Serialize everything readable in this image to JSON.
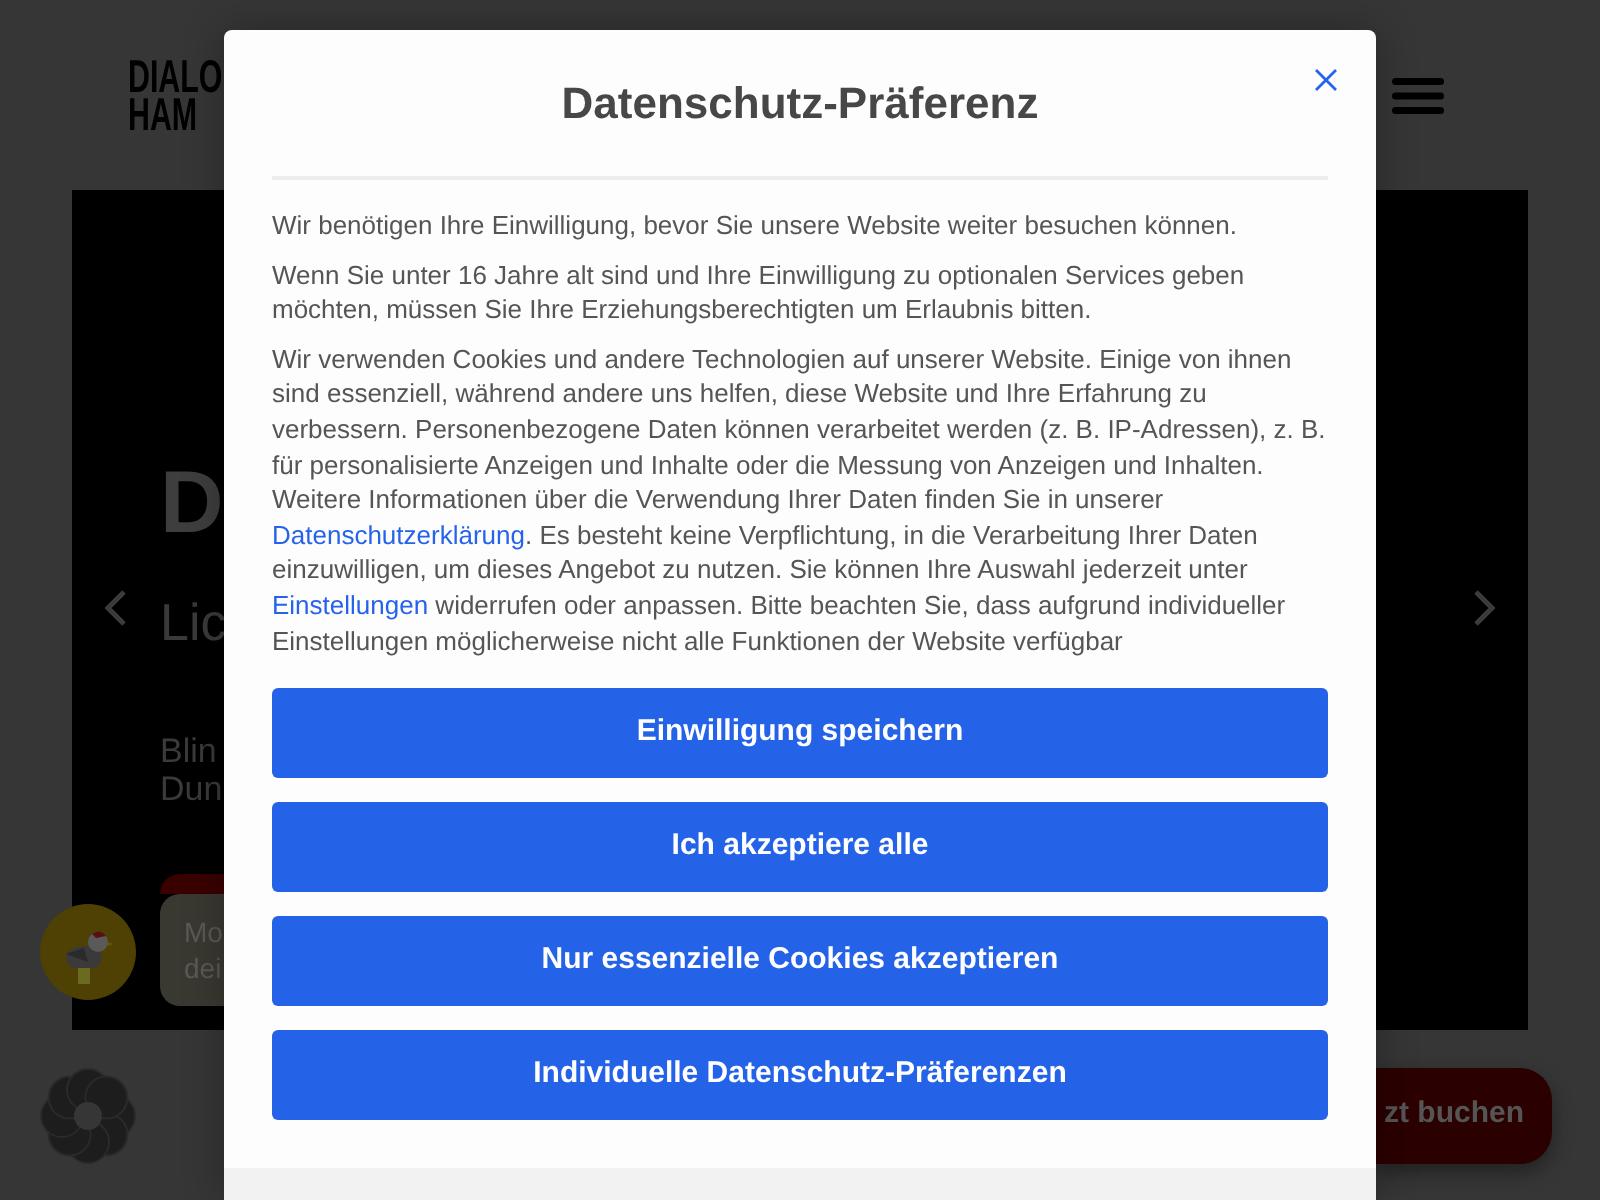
{
  "page": {
    "logo_lines": [
      "DIALO",
      "HAM"
    ],
    "hero": {
      "heading": "D",
      "subheading": "Lic",
      "text_lines": [
        "Blin",
        "Dun"
      ]
    },
    "chat": {
      "lines": [
        "Mo",
        "dei"
      ]
    },
    "book_button": "zt buchen"
  },
  "dialog": {
    "title": "Datenschutz-Präferenz",
    "paragraphs": [
      {
        "parts": [
          {
            "kind": "text",
            "text": "Wir benötigen Ihre Einwilligung, bevor Sie unsere Website weiter besuchen können."
          }
        ]
      },
      {
        "parts": [
          {
            "kind": "text",
            "text": "Wenn Sie unter 16 Jahre alt sind und Ihre Einwilligung zu optionalen Services geben möchten, müssen Sie Ihre Erziehungsberechtigten um Erlaubnis bitten."
          }
        ]
      },
      {
        "parts": [
          {
            "kind": "text",
            "text": "Wir verwenden Cookies und andere Technologien auf unserer Website. Einige von ihnen sind essenziell, während andere uns helfen, diese Website und Ihre Erfahrung zu verbessern. Personenbezogene Daten können verarbeitet werden (z. B. IP-Adressen), z. B. für personalisierte Anzeigen und Inhalte oder die Messung von Anzeigen und Inhalten. Weitere Informationen über die Verwendung Ihrer Daten finden Sie in unserer "
          },
          {
            "kind": "link",
            "text": "Datenschutzerklärung"
          },
          {
            "kind": "text",
            "text": ". Es besteht keine Verpflichtung, in die Verarbeitung Ihrer Daten einzuwilligen, um dieses Angebot zu nutzen. Sie können Ihre Auswahl jederzeit unter "
          },
          {
            "kind": "link",
            "text": "Einstellungen"
          },
          {
            "kind": "text",
            "text": " widerrufen oder anpassen. Bitte beachten Sie, dass aufgrund individueller Einstellungen möglicherweise nicht alle Funktionen der Website verfügbar"
          }
        ]
      }
    ],
    "buttons": [
      {
        "label": "Einwilligung speichern"
      },
      {
        "label": "Ich akzeptiere alle"
      },
      {
        "label": "Nur essenzielle Cookies akzeptieren"
      },
      {
        "label": "Individuelle Datenschutz-Präferenzen"
      }
    ]
  }
}
